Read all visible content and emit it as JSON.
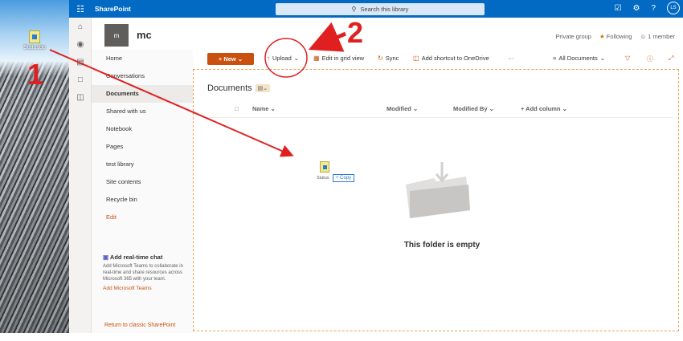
{
  "desktop": {
    "file_label": "Statusbo"
  },
  "topbar": {
    "app_name": "SharePoint",
    "search_placeholder": "Search this library",
    "user_initials": "LS"
  },
  "site": {
    "logo_letter": "m",
    "name": "mc",
    "privacy": "Private group",
    "following": "Following",
    "members": "1 member"
  },
  "nav": {
    "items": [
      "Home",
      "Conversations",
      "Documents",
      "Shared with us",
      "Notebook",
      "Pages",
      "test library",
      "Site contents",
      "Recycle bin",
      "Edit"
    ],
    "active": "Documents",
    "teams_heading": "Add real-time chat",
    "teams_body": "Add Microsoft Teams to collaborate in real-time and share resources across Microsoft 365 with your team.",
    "teams_link": "Add Microsoft Teams",
    "return_link": "Return to classic SharePoint"
  },
  "commandbar": {
    "new_label": "New",
    "upload_label": "Upload",
    "grid_label": "Edit in grid view",
    "sync_label": "Sync",
    "shortcut_label": "Add shortcut to OneDrive",
    "more_label": "···",
    "view_label": "All Documents"
  },
  "library": {
    "title": "Documents",
    "columns": [
      "Name",
      "Modified",
      "Modified By",
      "+ Add column"
    ],
    "empty_text": "This folder is empty",
    "drag_label": "Status",
    "copy_badge": "+ Copy"
  },
  "annotations": {
    "step1": "1",
    "step2": "2",
    "color": "#e02020"
  },
  "colors": {
    "suite_bar": "#036ac4",
    "accent": "#ca5010"
  }
}
